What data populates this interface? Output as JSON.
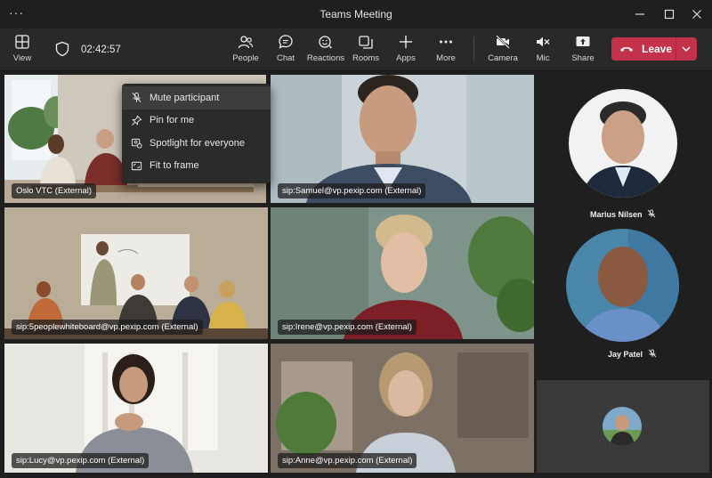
{
  "window": {
    "title": "Teams Meeting",
    "menu": "···"
  },
  "toolbar": {
    "view": "View",
    "timer": "02:42:57",
    "people": "People",
    "chat": "Chat",
    "reactions": "Reactions",
    "rooms": "Rooms",
    "apps": "Apps",
    "more": "More",
    "camera": "Camera",
    "mic": "Mic",
    "share": "Share",
    "leave": "Leave"
  },
  "context_menu": {
    "items": [
      "Mute participant",
      "Pin for me",
      "Spotlight for everyone",
      "Fit to frame"
    ]
  },
  "tiles": [
    {
      "label": "Oslo VTC (External)"
    },
    {
      "label": "sip:Samuel@vp.pexip.com (External)"
    },
    {
      "label": "sip:5peoplewhiteboard@vp.pexip.com (External)"
    },
    {
      "label": "sip:Irene@vp.pexip.com (External)"
    },
    {
      "label": "sip:Lucy@vp.pexip.com (External)"
    },
    {
      "label": "sip:Anne@vp.pexip.com (External)"
    }
  ],
  "side": {
    "participants": [
      {
        "name": "Marius Nilsen"
      },
      {
        "name": "Jay Patel"
      }
    ]
  },
  "colors": {
    "leave": "#c4314b",
    "selected_outline": "#a6a7e4",
    "background": "#1f1f1f"
  }
}
